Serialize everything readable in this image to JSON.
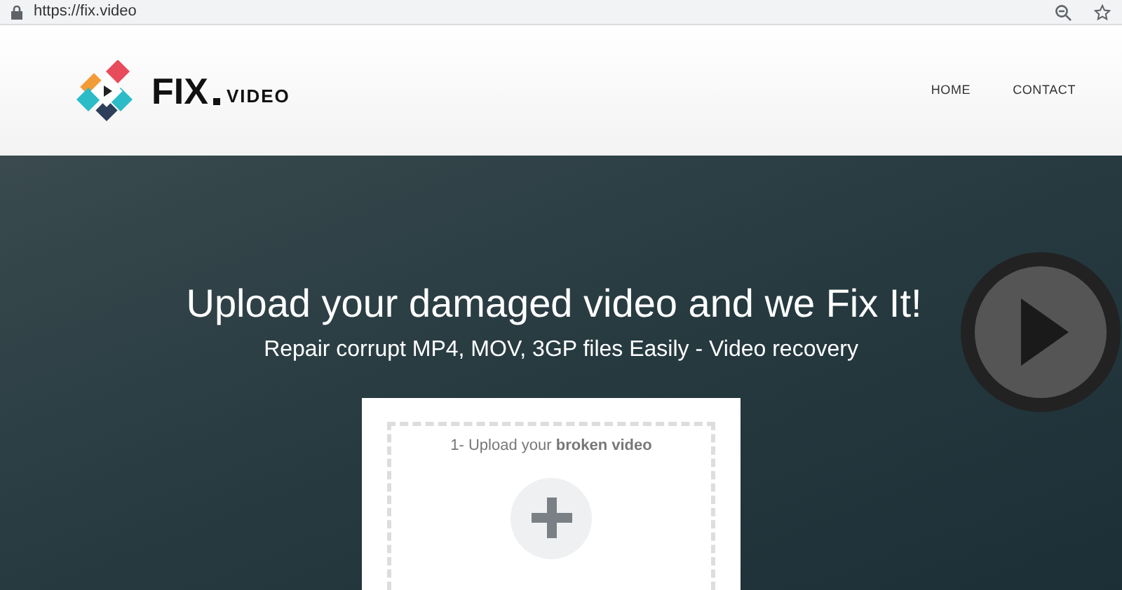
{
  "browser": {
    "url": "https://fix.video"
  },
  "header": {
    "logo": {
      "main": "FIX",
      "sub": "VIDEO"
    },
    "nav": [
      {
        "label": "HOME"
      },
      {
        "label": "CONTACT"
      }
    ]
  },
  "hero": {
    "title": "Upload your damaged video and we Fix It!",
    "subtitle": "Repair corrupt MP4, MOV, 3GP files Easily - Video recovery"
  },
  "upload": {
    "label": "1- Upload your **broken video**"
  }
}
